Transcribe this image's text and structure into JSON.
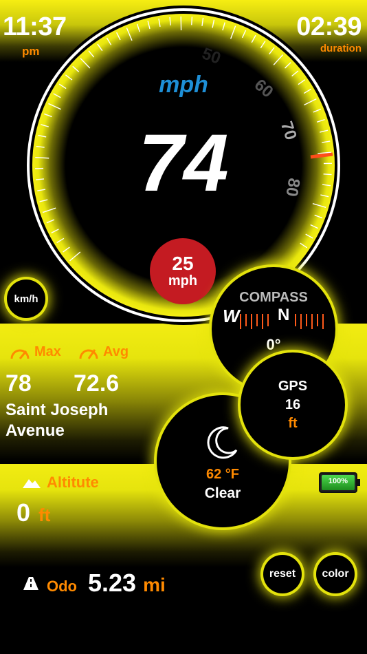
{
  "header": {
    "time": "11:37",
    "time_period": "pm",
    "duration": "02:39",
    "duration_label": "duration"
  },
  "speedometer": {
    "unit": "mph",
    "speed": "74",
    "ticks": [
      "50",
      "60",
      "70",
      "80"
    ],
    "limit_value": "25",
    "limit_unit": "mph"
  },
  "unit_toggle": {
    "label": "km/h"
  },
  "compass": {
    "title": "COMPASS",
    "letters": [
      "W",
      "N"
    ],
    "heading": "0°"
  },
  "stats": {
    "max_label": "Max",
    "avg_label": "Avg",
    "max_value": "78",
    "avg_value": "72.6",
    "street_line1": "Saint Joseph",
    "street_line2": "Avenue"
  },
  "gps": {
    "label": "GPS",
    "value": "16",
    "unit": "ft"
  },
  "weather": {
    "temperature": "62 °F",
    "condition": "Clear",
    "icon": "moon-icon"
  },
  "altitude": {
    "label": "Altitute",
    "value": "0",
    "unit": "ft",
    "icon": "mountain-icon"
  },
  "battery": {
    "label": "100%",
    "level": 1.0
  },
  "odometer": {
    "label": "Odo",
    "value": "5.23",
    "unit": "mi",
    "icon": "road-icon"
  },
  "buttons": {
    "reset": "reset",
    "color": "color"
  },
  "colors": {
    "accent": "#e3e20c",
    "orange": "#ff8a00",
    "blue": "#1e8fd6",
    "limit_red": "#c41b22"
  }
}
